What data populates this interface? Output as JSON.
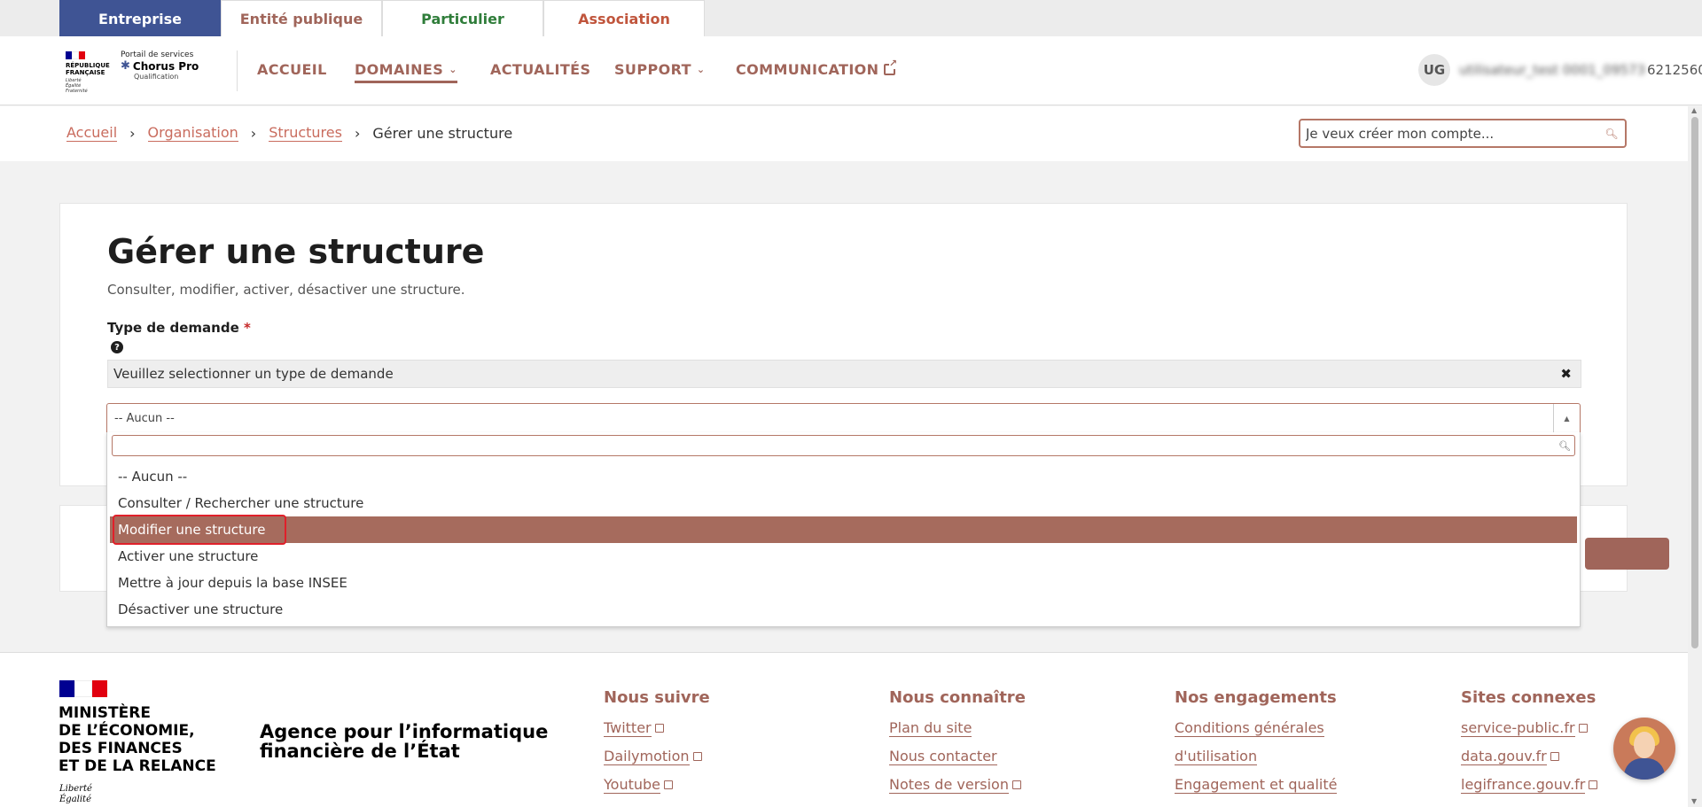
{
  "audience_tabs": [
    {
      "label": "Entreprise",
      "color": "#ffffff"
    },
    {
      "label": "Entité publique",
      "color": "#a0655a"
    },
    {
      "label": "Particulier",
      "color": "#2f7d3a"
    },
    {
      "label": "Association",
      "color": "#c0553c"
    }
  ],
  "header": {
    "rf_lines": [
      "RÉPUBLIQUE",
      "FRANÇAISE"
    ],
    "rf_motto": [
      "Liberté",
      "Égalité",
      "Fraternité"
    ],
    "portal_line1": "Portail de services",
    "portal_name": "Chorus Pro",
    "portal_env": "Qualification",
    "nav": [
      "ACCUEIL",
      "DOMAINES",
      "ACTUALITÉS",
      "SUPPORT",
      "COMMUNICATION"
    ],
    "user_initials": "UG",
    "user_name": "utilisateur_test 0001_09573",
    "user_id": "6212560"
  },
  "breadcrumb": {
    "items": [
      "Accueil",
      "Organisation",
      "Structures"
    ],
    "current": "Gérer une structure"
  },
  "search": {
    "placeholder": "Je veux créer mon compte..."
  },
  "main": {
    "title": "Gérer une structure",
    "subtitle": "Consulter, modifier, activer, désactiver une structure.",
    "field_label": "Type de demande",
    "required_mark": "*",
    "alert": "Veuillez selectionner un type de demande",
    "select_value": "-- Aucun --",
    "options": [
      "-- Aucun --",
      "Consulter / Rechercher une structure",
      "Modifier une structure",
      "Activer une structure",
      "Mettre à jour depuis la base INSEE",
      "Désactiver une structure"
    ],
    "highlighted_option": "Modifier une structure"
  },
  "footer": {
    "ministry": [
      "MINISTÈRE",
      "DE L’ÉCONOMIE,",
      "DES FINANCES",
      "ET DE LA RELANCE"
    ],
    "motto": [
      "Liberté",
      "Égalité"
    ],
    "agency": [
      "Agence pour l’informatique",
      "financière de l’État"
    ],
    "columns": [
      {
        "title": "Nous suivre",
        "links": [
          "Twitter",
          "Dailymotion",
          "Youtube"
        ]
      },
      {
        "title": "Nous connaître",
        "links": [
          "Plan du site",
          "Nous contacter",
          "Notes de version"
        ]
      },
      {
        "title": "Nos engagements",
        "links": [
          "Conditions générales",
          "d'utilisation",
          "Engagement et qualité"
        ]
      },
      {
        "title": "Sites connexes",
        "links": [
          "service-public.fr",
          "data.gouv.fr",
          "legifrance.gouv.fr"
        ]
      }
    ]
  },
  "colors": {
    "accent": "#a0655a",
    "primary_blue": "#3f5494",
    "highlight": "#a66b5d",
    "focus_red": "#e0202a"
  }
}
